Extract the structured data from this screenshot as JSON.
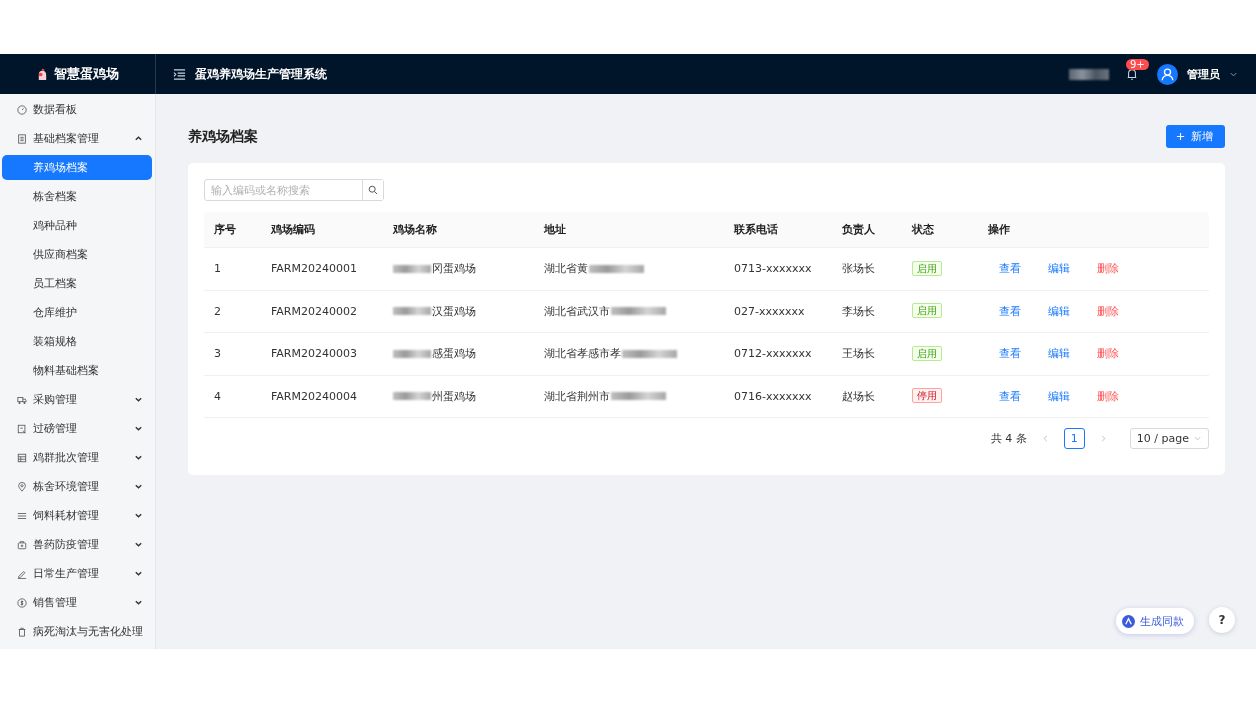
{
  "header": {
    "logo": "智慧蛋鸡场",
    "title": "蛋鸡养鸡场生产管理系统",
    "notification_badge": "9+",
    "user": "管理员"
  },
  "sidebar": {
    "items": [
      {
        "label": "数据看板",
        "selected": false
      },
      {
        "label": "基础档案管理",
        "expanded": true,
        "selected": false,
        "children": [
          {
            "label": "养鸡场档案",
            "selected": true
          },
          {
            "label": "栋舍档案",
            "selected": false
          },
          {
            "label": "鸡种品种",
            "selected": false
          },
          {
            "label": "供应商档案",
            "selected": false
          },
          {
            "label": "员工档案",
            "selected": false
          },
          {
            "label": "仓库维护",
            "selected": false
          },
          {
            "label": "装箱规格",
            "selected": false
          },
          {
            "label": "物料基础档案",
            "selected": false
          }
        ]
      },
      {
        "label": "采购管理",
        "expanded": false,
        "selected": false
      },
      {
        "label": "过磅管理",
        "expanded": false,
        "selected": false
      },
      {
        "label": "鸡群批次管理",
        "expanded": false,
        "selected": false
      },
      {
        "label": "栋舍环境管理",
        "expanded": false,
        "selected": false
      },
      {
        "label": "饲料耗材管理",
        "expanded": false,
        "selected": false
      },
      {
        "label": "兽药防疫管理",
        "expanded": false,
        "selected": false
      },
      {
        "label": "日常生产管理",
        "expanded": false,
        "selected": false
      },
      {
        "label": "销售管理",
        "expanded": false,
        "selected": false
      },
      {
        "label": "病死淘汰与无害化处理",
        "selected": false
      }
    ]
  },
  "page": {
    "title": "养鸡场档案",
    "add_button": "新增"
  },
  "search": {
    "placeholder": "输入编码或名称搜索"
  },
  "table": {
    "columns": [
      "序号",
      "鸡场编码",
      "鸡场名称",
      "地址",
      "联系电话",
      "负责人",
      "状态",
      "操作"
    ],
    "rows": [
      {
        "no": "1",
        "code": "FARM20240001",
        "name": "冈蛋鸡场",
        "address": "湖北省黄",
        "phone": "0713-xxxxxxx",
        "manager": "张场长",
        "status": "启用",
        "enabled": true,
        "actions": [
          "查看",
          "编辑",
          "删除"
        ]
      },
      {
        "no": "2",
        "code": "FARM20240002",
        "name": "汉蛋鸡场",
        "address": "湖北省武汉市",
        "phone": "027-xxxxxxx",
        "manager": "李场长",
        "status": "启用",
        "enabled": true,
        "actions": [
          "查看",
          "编辑",
          "删除"
        ]
      },
      {
        "no": "3",
        "code": "FARM20240003",
        "name": "感蛋鸡场",
        "address": "湖北省孝感市孝",
        "phone": "0712-xxxxxxx",
        "manager": "王场长",
        "status": "启用",
        "enabled": true,
        "actions": [
          "查看",
          "编辑",
          "删除"
        ]
      },
      {
        "no": "4",
        "code": "FARM20240004",
        "name": "州蛋鸡场",
        "address": "湖北省荆州市",
        "phone": "0716-xxxxxxx",
        "manager": "赵场长",
        "status": "停用",
        "enabled": false,
        "actions": [
          "查看",
          "编辑",
          "删除"
        ]
      }
    ]
  },
  "pagination": {
    "total": "共 4 条",
    "pages": [
      {
        "label": "1",
        "selected": true
      }
    ],
    "page_size": "10 / page"
  },
  "floating": {
    "generate_button": "生成同款",
    "help_button": "?"
  }
}
